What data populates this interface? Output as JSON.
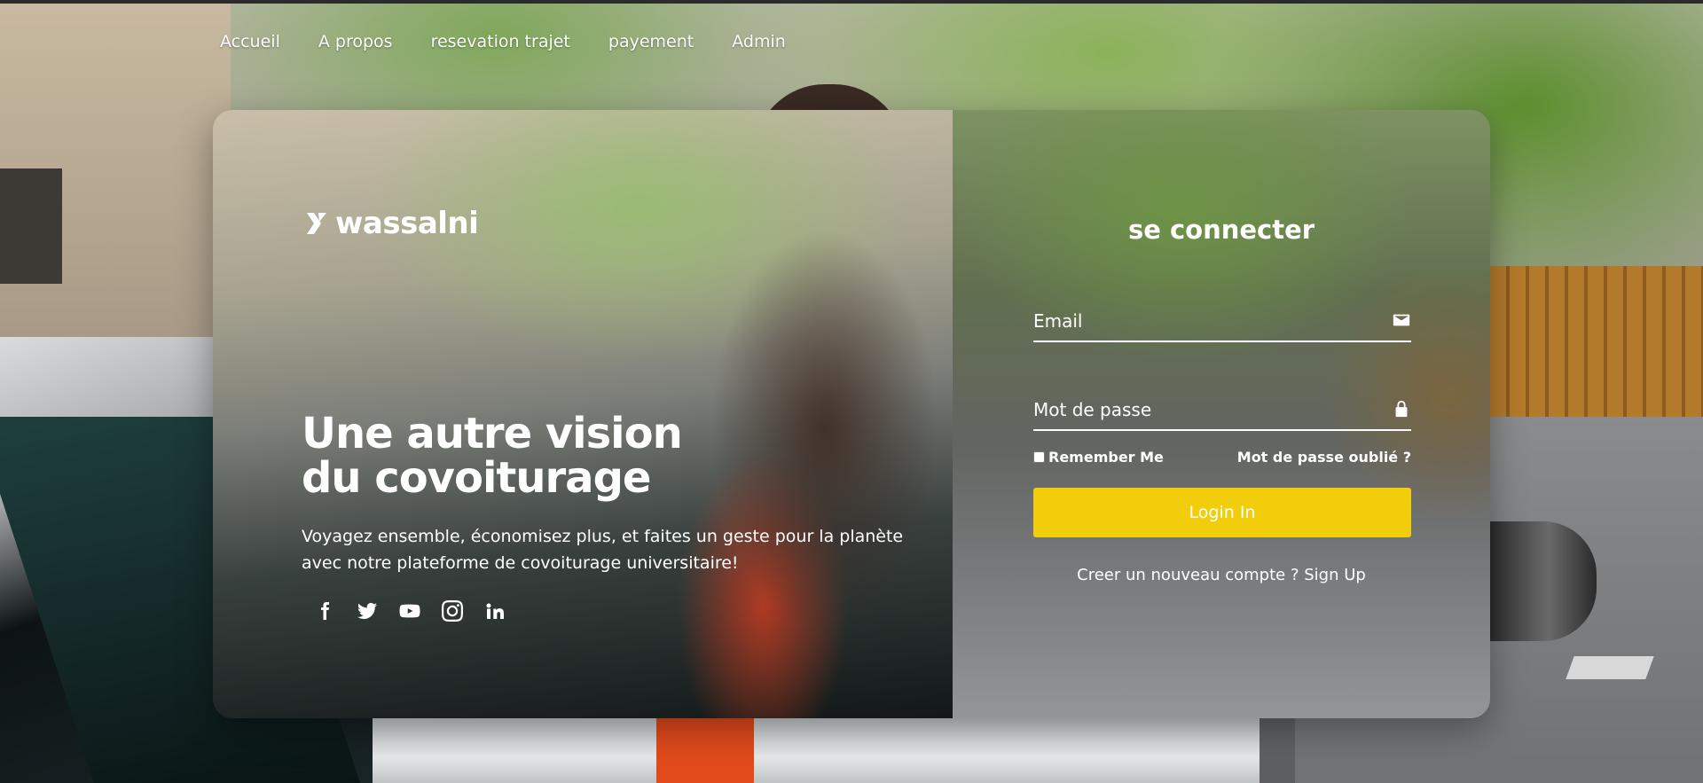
{
  "nav": {
    "items": [
      {
        "label": "Accueil"
      },
      {
        "label": "A propos"
      },
      {
        "label": "resevation trajet"
      },
      {
        "label": "payement"
      },
      {
        "label": "Admin"
      }
    ]
  },
  "hero": {
    "brand": "wassalni",
    "headline_line1": "Une autre vision",
    "headline_line2": "du covoiturage",
    "subtitle": "Voyagez ensemble, économisez plus, et faites un geste pour la planète avec notre plateforme de covoiturage universitaire!",
    "socials": [
      "facebook-icon",
      "twitter-icon",
      "youtube-icon",
      "instagram-icon",
      "linkedin-icon"
    ]
  },
  "login": {
    "title": "se connecter",
    "email_placeholder": "Email",
    "password_placeholder": "Mot de passe",
    "remember_label": "Remember Me",
    "forgot_label": "Mot de passe oublié ?",
    "submit_label": "Login In",
    "signup_text": "Creer un nouveau compte ?",
    "signup_link": "Sign Up"
  },
  "colors": {
    "accent": "#f1cd0b",
    "text": "#ffffff"
  }
}
